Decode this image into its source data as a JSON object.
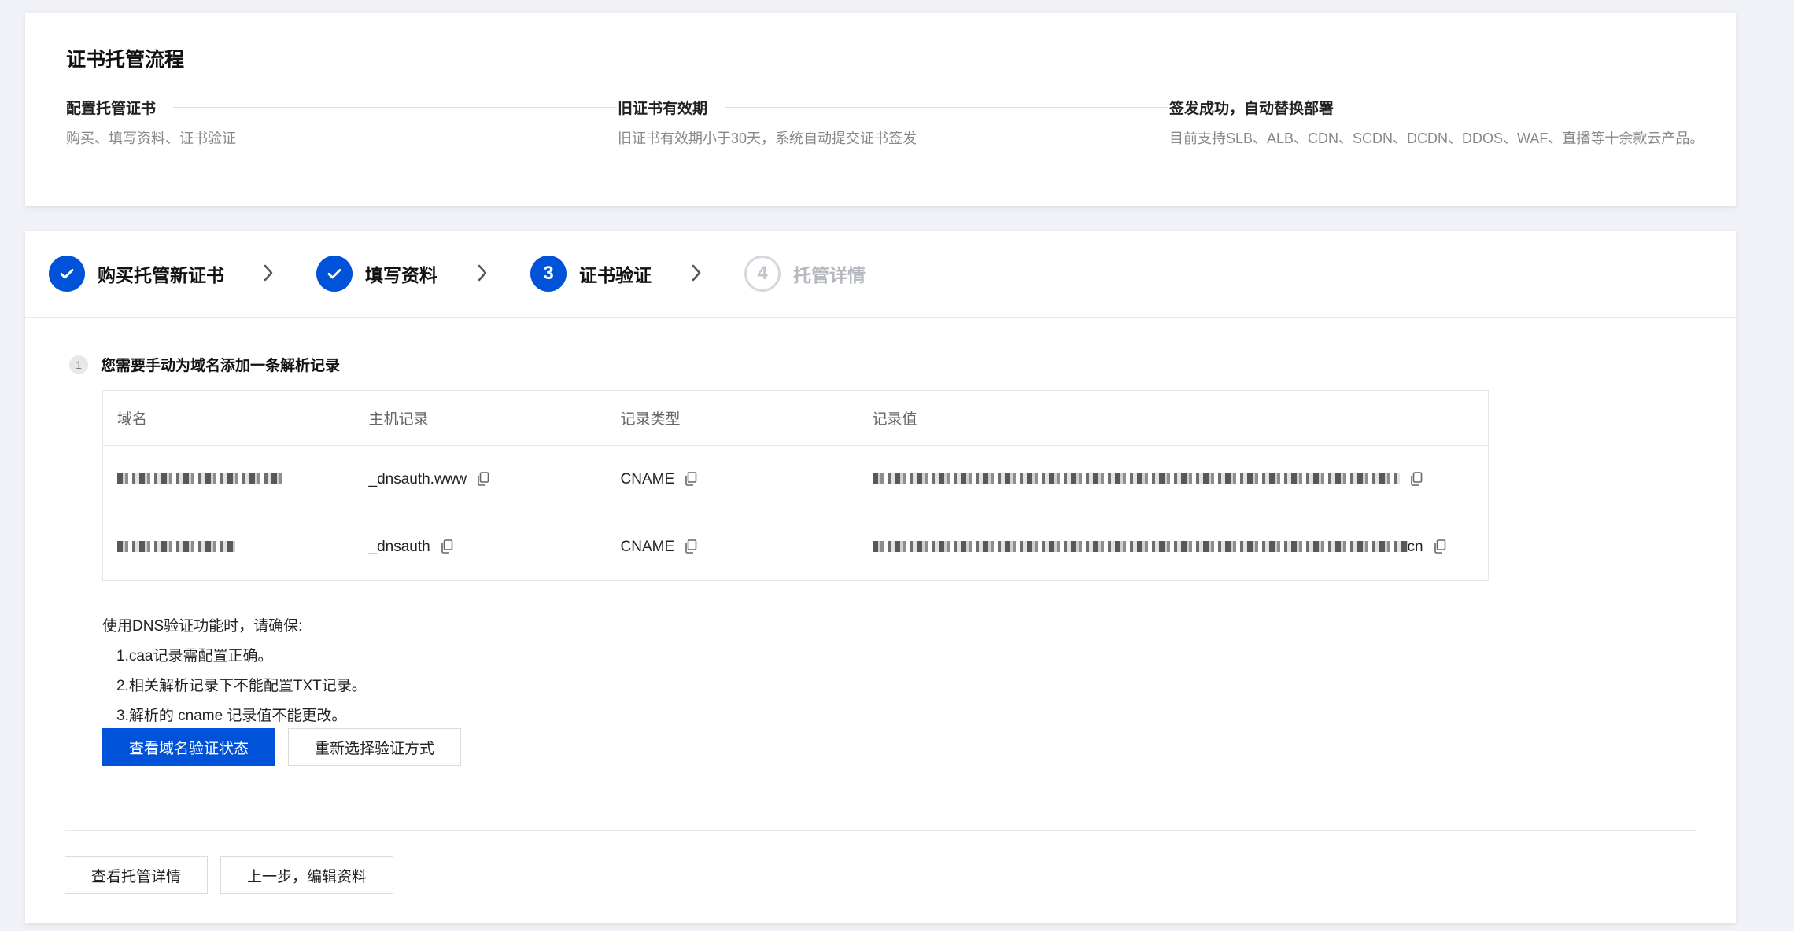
{
  "flow": {
    "title": "证书托管流程",
    "steps": [
      {
        "name": "配置托管证书",
        "desc": "购买、填写资料、证书验证"
      },
      {
        "name": "旧证书有效期",
        "desc": "旧证书有效期小于30天，系统自动提交证书签发"
      },
      {
        "name": "签发成功，自动替换部署",
        "desc": "目前支持SLB、ALB、CDN、SCDN、DCDN、DDOS、WAF、直播等十余款云产品。"
      }
    ]
  },
  "wizard": {
    "steps": [
      {
        "num": "",
        "label": "购买托管新证书",
        "state": "done"
      },
      {
        "num": "",
        "label": "填写资料",
        "state": "done"
      },
      {
        "num": "3",
        "label": "证书验证",
        "state": "active"
      },
      {
        "num": "4",
        "label": "托管详情",
        "state": "todo"
      }
    ]
  },
  "notice": {
    "num": "1",
    "text": "您需要手动为域名添加一条解析记录"
  },
  "table": {
    "headers": [
      "域名",
      "主机记录",
      "记录类型",
      "记录值"
    ],
    "rows": [
      {
        "domain": "",
        "host": "_dnsauth.www",
        "type": "CNAME",
        "value": "",
        "value_suffix": ""
      },
      {
        "domain": "",
        "host": "_dnsauth",
        "type": "CNAME",
        "value": "",
        "value_suffix": "cn"
      }
    ]
  },
  "tips": {
    "intro": "使用DNS验证功能时，请确保:",
    "items": [
      "1.caa记录需配置正确。",
      "2.相关解析记录下不能配置TXT记录。",
      "3.解析的 cname 记录值不能更改。"
    ]
  },
  "buttons": {
    "check_status": "查看域名验证状态",
    "reselect": "重新选择验证方式",
    "view_details": "查看托管详情",
    "prev_step": "上一步，编辑资料"
  },
  "colors": {
    "primary": "#0052d9",
    "background": "#f0f2f7"
  }
}
